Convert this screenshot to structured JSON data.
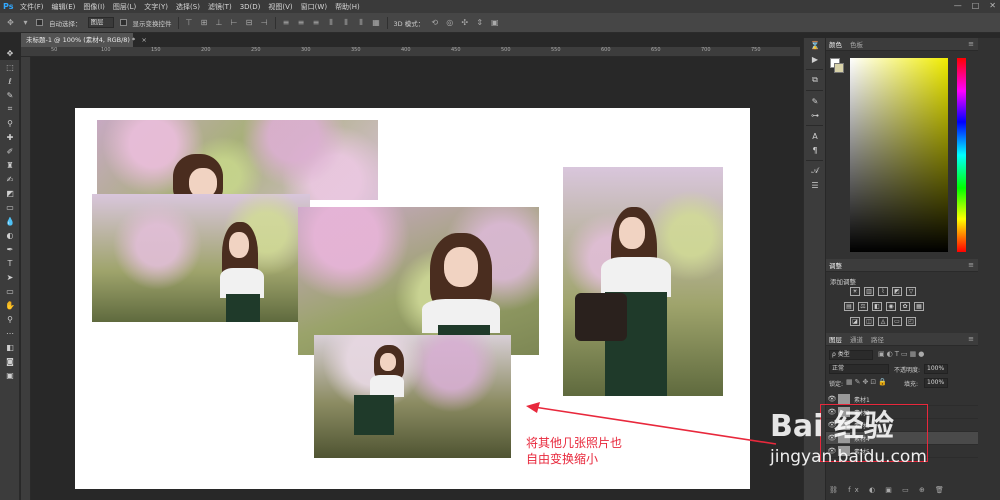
{
  "app": {
    "logo": "Ps",
    "menu": [
      "文件(F)",
      "编辑(E)",
      "图像(I)",
      "图层(L)",
      "文字(Y)",
      "选择(S)",
      "滤镜(T)",
      "3D(D)",
      "视图(V)",
      "窗口(W)",
      "帮助(H)"
    ],
    "window_controls": [
      "—",
      "□",
      "✕"
    ]
  },
  "options": {
    "auto_select_label": "自动选择：",
    "auto_select_value": "图层",
    "show_transform_label": "显示变换控件",
    "mode_3d_label": "3D 模式："
  },
  "document": {
    "tab_title": "未标题-1 @ 100% (素材4, RGB/8) *",
    "close": "×"
  },
  "ruler_ticks": [
    "50",
    "100",
    "150",
    "200",
    "250",
    "300",
    "350",
    "400",
    "450",
    "500",
    "550",
    "600",
    "650",
    "700",
    "750"
  ],
  "annotation": {
    "line1": "将其他几张照片也",
    "line2": "自由变换缩小",
    "color": "#e8283c"
  },
  "panels": {
    "color": {
      "tabs": [
        "颜色",
        "色板"
      ]
    },
    "adjust": {
      "title": "调整",
      "subtitle": "添加调整"
    },
    "layers": {
      "tabs": [
        "图层",
        "通道",
        "路径"
      ],
      "filter_label": "ρ 类型",
      "blend_mode": "正常",
      "opacity_label": "不透明度:",
      "opacity": "100%",
      "lock_label": "锁定:",
      "fill_label": "填充:",
      "fill": "100%",
      "rows": [
        {
          "name": "素材1",
          "selected": false
        },
        {
          "name": "素材2",
          "selected": false
        },
        {
          "name": "素材3",
          "selected": false
        },
        {
          "name": "素材4",
          "selected": true
        },
        {
          "name": "素材5",
          "selected": false
        }
      ]
    }
  },
  "watermark": {
    "brand": "Bai 经验",
    "url": "jingyan.baidu.com"
  }
}
